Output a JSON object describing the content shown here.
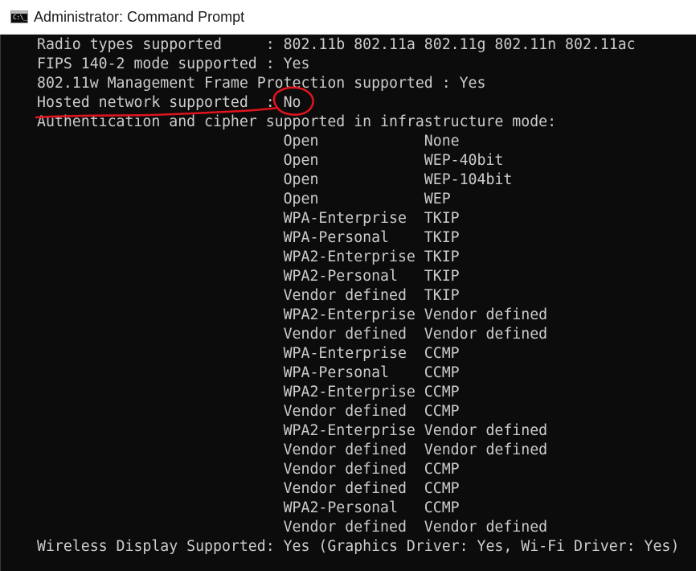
{
  "window": {
    "title": "Administrator: Command Prompt",
    "icon": "cmd-icon",
    "icon_glyph": "C:\\_"
  },
  "console": {
    "lines": [
      "Radio types supported     : 802.11b 802.11a 802.11g 802.11n 802.11ac",
      "FIPS 140-2 mode supported : Yes",
      "802.11w Management Frame Protection supported : Yes",
      "Hosted network supported  : No",
      "Authentication and cipher supported in infrastructure mode:",
      "                            Open            None",
      "                            Open            WEP-40bit",
      "                            Open            WEP-104bit",
      "                            Open            WEP",
      "                            WPA-Enterprise  TKIP",
      "                            WPA-Personal    TKIP",
      "                            WPA2-Enterprise TKIP",
      "                            WPA2-Personal   TKIP",
      "                            Vendor defined  TKIP",
      "                            WPA2-Enterprise Vendor defined",
      "                            Vendor defined  Vendor defined",
      "                            WPA-Enterprise  CCMP",
      "                            WPA-Personal    CCMP",
      "                            WPA2-Enterprise CCMP",
      "                            Vendor defined  CCMP",
      "                            WPA2-Enterprise Vendor defined",
      "                            Vendor defined  Vendor defined",
      "                            Vendor defined  CCMP",
      "                            Vendor defined  CCMP",
      "                            WPA2-Personal   CCMP",
      "                            Vendor defined  Vendor defined",
      "Wireless Display Supported: Yes (Graphics Driver: Yes, Wi-Fi Driver: Yes)"
    ]
  },
  "colors": {
    "console_bg": "#0c0c0c",
    "console_text": "#cccccc",
    "annotation": "#e0141e"
  }
}
